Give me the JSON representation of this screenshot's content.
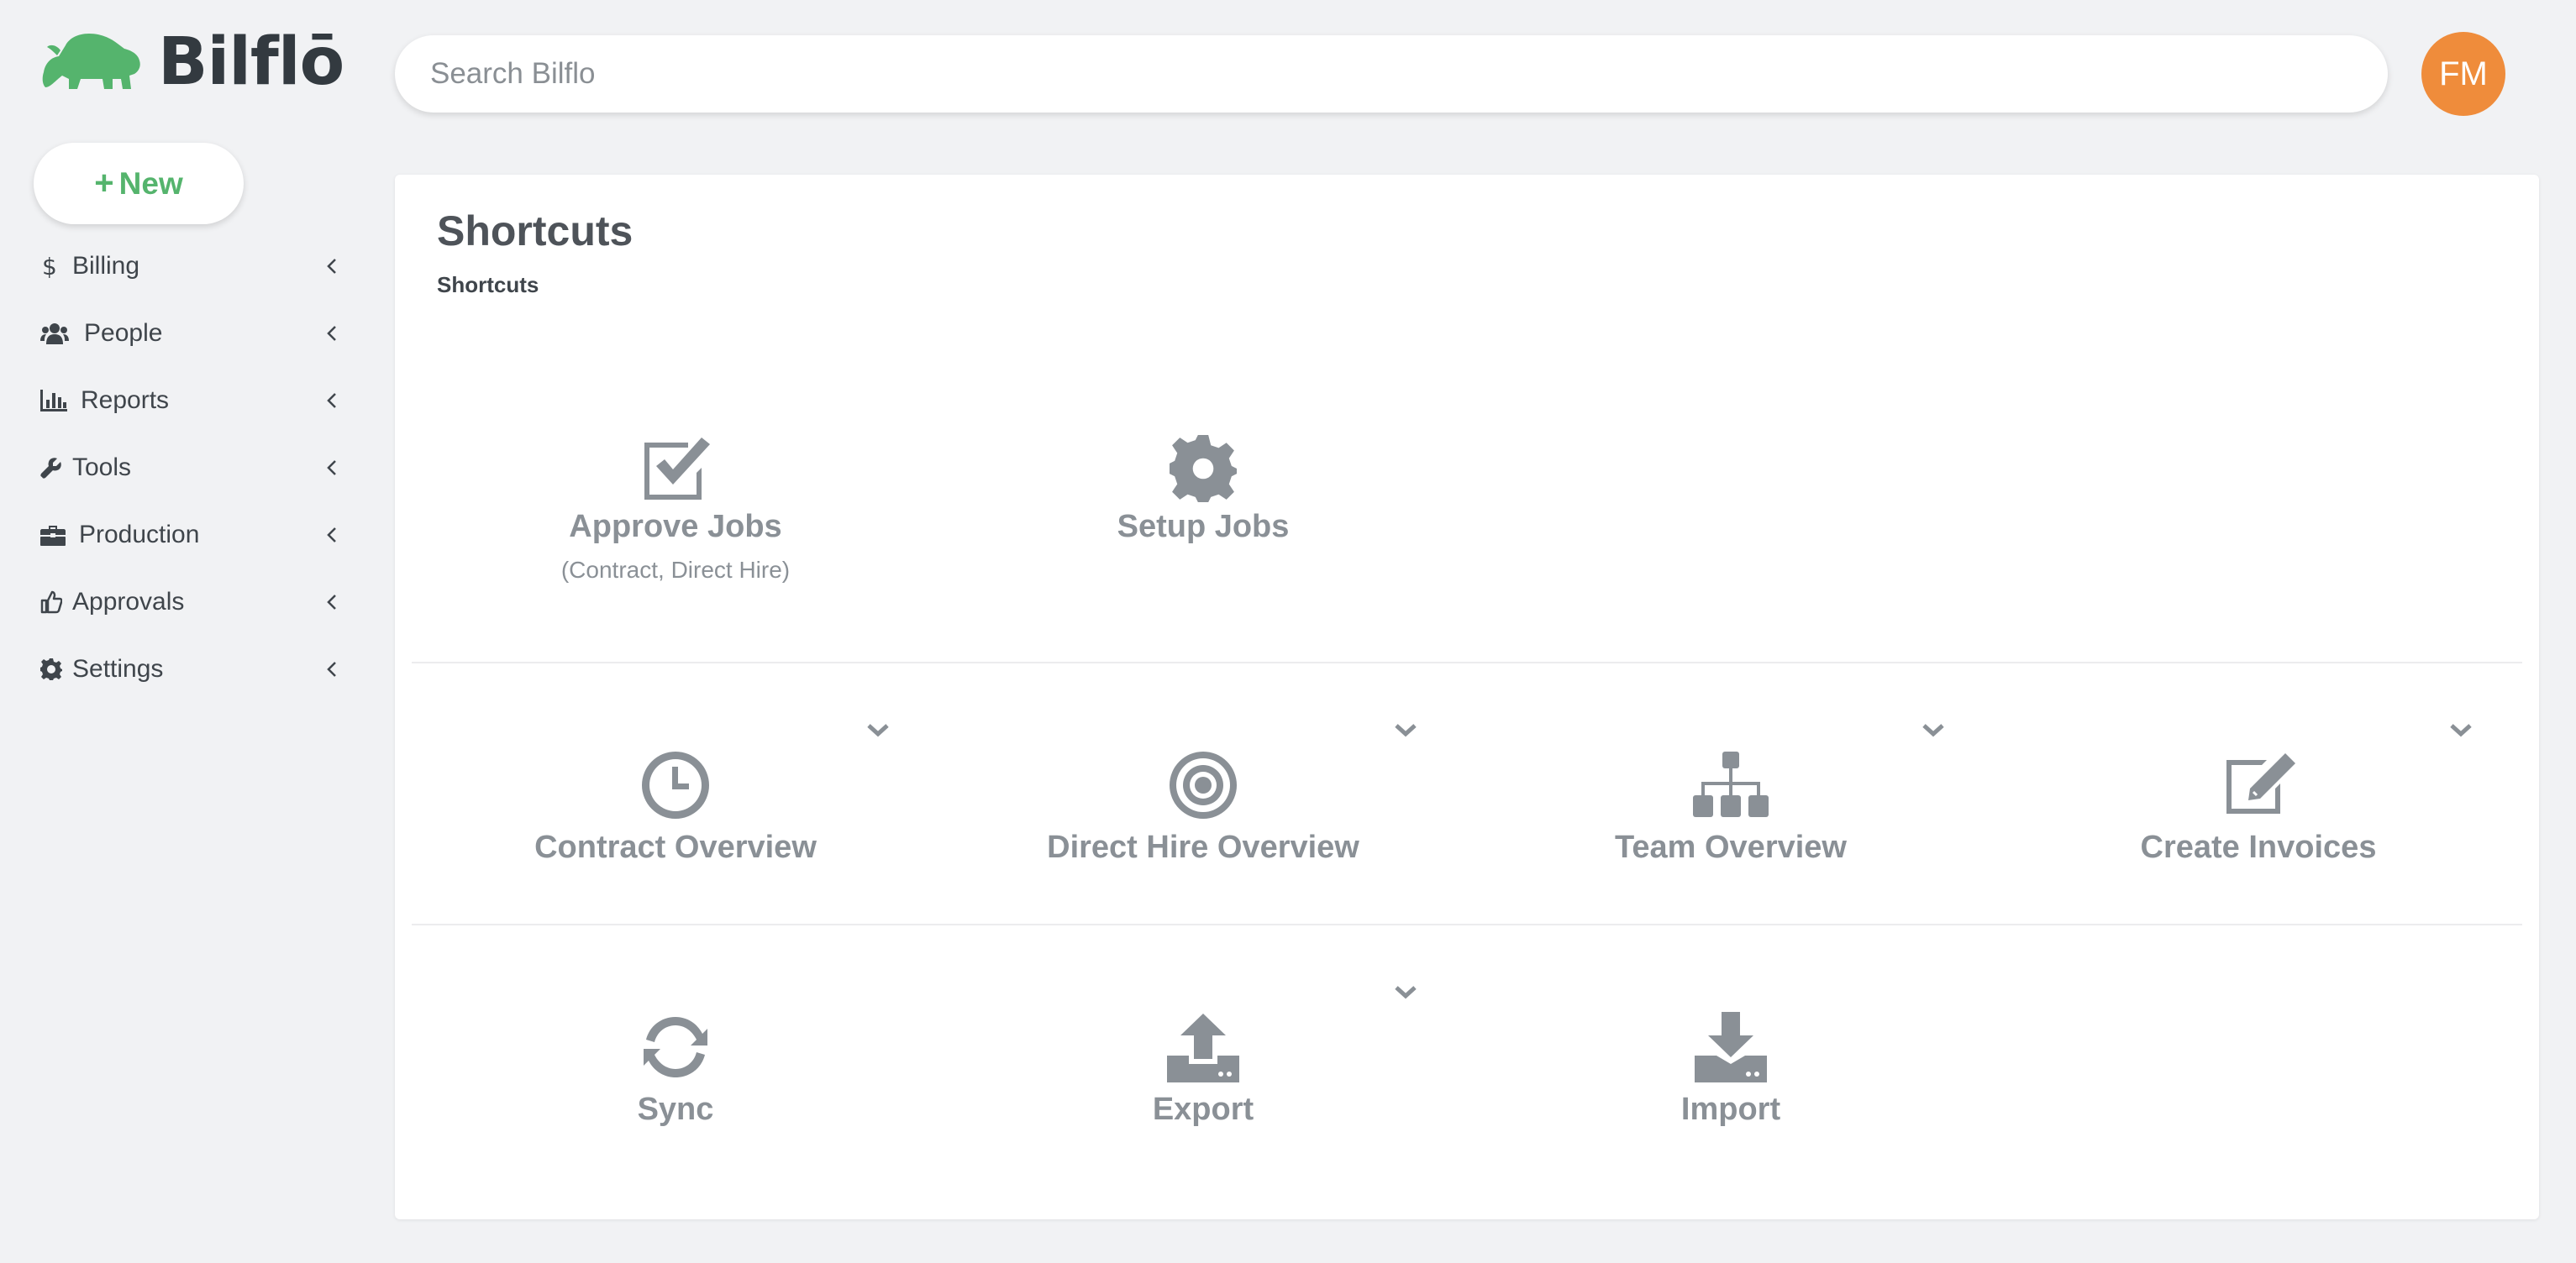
{
  "app": {
    "logo_text": "Bilflō"
  },
  "search": {
    "placeholder": "Search Bilflo"
  },
  "user": {
    "initials": "FM",
    "avatar_color": "#ef8c3b"
  },
  "new_button": {
    "label": "New"
  },
  "sidebar": {
    "items": [
      {
        "label": "Billing",
        "icon": "dollar-icon"
      },
      {
        "label": "People",
        "icon": "users-icon"
      },
      {
        "label": "Reports",
        "icon": "bar-chart-icon"
      },
      {
        "label": "Tools",
        "icon": "wrench-icon"
      },
      {
        "label": "Production",
        "icon": "briefcase-icon"
      },
      {
        "label": "Approvals",
        "icon": "thumbs-up-icon"
      },
      {
        "label": "Settings",
        "icon": "gear-icon"
      }
    ]
  },
  "main": {
    "title": "Shortcuts",
    "breadcrumb": "Shortcuts",
    "shortcuts": [
      {
        "label": "Approve Jobs",
        "sub": "(Contract, Direct Hire)",
        "icon": "checkbox-icon"
      },
      {
        "label": "Setup Jobs",
        "icon": "gear-icon"
      },
      {
        "label": "Contract Overview",
        "icon": "clock-icon",
        "has_dropdown": true
      },
      {
        "label": "Direct Hire Overview",
        "icon": "target-icon",
        "has_dropdown": true
      },
      {
        "label": "Team Overview",
        "icon": "org-chart-icon",
        "has_dropdown": true
      },
      {
        "label": "Create Invoices",
        "icon": "edit-icon",
        "has_dropdown": true
      },
      {
        "label": "Sync",
        "icon": "sync-icon"
      },
      {
        "label": "Export",
        "icon": "upload-icon",
        "has_dropdown": true
      },
      {
        "label": "Import",
        "icon": "download-icon"
      }
    ]
  },
  "colors": {
    "brand_green": "#55b46d",
    "icon_gray": "#8a9096",
    "background": "#f1f2f4"
  }
}
